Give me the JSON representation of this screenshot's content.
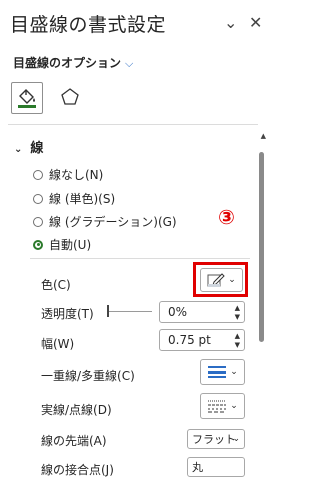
{
  "pane": {
    "title": "目盛線の書式設定",
    "subtitle": "目盛線のオプション",
    "close_label": "✕",
    "chevron_label": "⌄"
  },
  "section": {
    "title": "線",
    "arrow": "⌄"
  },
  "radios": [
    {
      "label": "線なし(N)",
      "selected": false
    },
    {
      "label": "線 (単色)(S)",
      "selected": false
    },
    {
      "label": "線 (グラデーション)(G)",
      "selected": false
    },
    {
      "label": "自動(U)",
      "selected": true
    }
  ],
  "fields": {
    "color_label": "色(C)",
    "transparency_label": "透明度(T)",
    "transparency_value": "0%",
    "width_label": "幅(W)",
    "width_value": "0.75 pt",
    "compound_label": "一重線/多重線(C)",
    "dash_label": "実線/点線(D)",
    "cap_label": "線の先端(A)",
    "cap_value": "フラット",
    "join_label": "線の接合点(J)",
    "join_value": "丸"
  },
  "annotation": {
    "marker": "③",
    "color": "#e00000"
  },
  "colors": {
    "accent_green": "#2b7a2b",
    "accent_blue": "#2b6cc4"
  }
}
